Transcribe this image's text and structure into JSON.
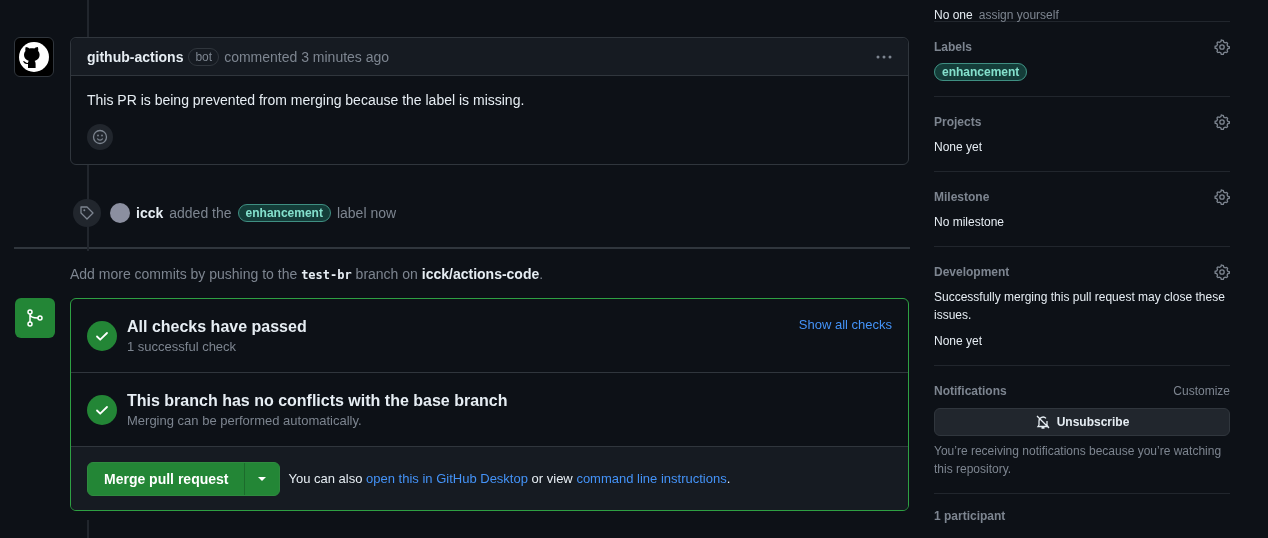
{
  "comment": {
    "author": "github-actions",
    "badge": "bot",
    "meta": "commented 3 minutes ago",
    "body": "This PR is being prevented from merging because the label is missing."
  },
  "label_event": {
    "user": "icck",
    "text_before": "added the",
    "label": "enhancement",
    "text_after": "label now"
  },
  "push_hint": {
    "prefix": "Add more commits by pushing to the",
    "branch": "test-br",
    "middle": "branch on",
    "repo": "icck/actions-code",
    "suffix": "."
  },
  "merge_box": {
    "checks": [
      {
        "title": "All checks have passed",
        "subtitle": "1 successful check",
        "passed": true,
        "link": "Show all checks"
      },
      {
        "title": "This branch has no conflicts with the base branch",
        "subtitle": "Merging can be performed automatically.",
        "passed": true
      }
    ],
    "merge_button": "Merge pull request",
    "footer": {
      "prefix": "You can also",
      "link1": "open this in GitHub Desktop",
      "middle": "or view",
      "link2": "command line instructions",
      "suffix": "."
    }
  },
  "sidebar": {
    "assignees": {
      "value": "No one",
      "hint": "assign yourself"
    },
    "sections": [
      {
        "kind": "labels",
        "title": "Labels",
        "labels": [
          "enhancement"
        ]
      },
      {
        "kind": "text",
        "title": "Projects",
        "lines": [
          "None yet"
        ]
      },
      {
        "kind": "text",
        "title": "Milestone",
        "lines": [
          "No milestone"
        ]
      },
      {
        "kind": "text",
        "title": "Development",
        "lines": [
          "Successfully merging this pull request may close these issues.",
          "None yet"
        ]
      },
      {
        "kind": "notifications",
        "title": "Notifications",
        "action": "Customize",
        "button": "Unsubscribe",
        "note": "You’re receiving notifications because you’re watching this repository."
      }
    ],
    "participants": "1 participant"
  }
}
